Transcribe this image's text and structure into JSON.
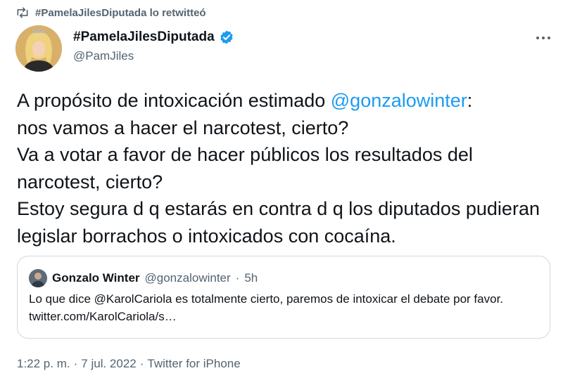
{
  "retweet": {
    "label": "#PamelaJilesDiputada lo retwitteó"
  },
  "author": {
    "display_name": "#PamelaJilesDiputada",
    "handle": "@PamJiles"
  },
  "tweet": {
    "text_part1": "A propósito de intoxicación estimado ",
    "mention": "@gonzalowinter",
    "text_part2": ":\nnos vamos a hacer el narcotest, cierto?\nVa a votar a favor de hacer públicos los resultados del narcotest, cierto?\nEstoy segura d q estarás en contra d q los diputados pudieran legislar borrachos o intoxicados con cocaína."
  },
  "quote": {
    "name": "Gonzalo Winter",
    "handle": "@gonzalowinter",
    "sep": "·",
    "time": "5h",
    "text": "Lo que dice @KarolCariola es totalmente cierto, paremos de intoxicar el debate por favor. twitter.com/KarolCariola/s…"
  },
  "meta": {
    "time": "1:22 p. m.",
    "sep1": "·",
    "date": "7 jul. 2022",
    "sep2": "·",
    "source": "Twitter for iPhone"
  },
  "colors": {
    "accent": "#1d9bf0",
    "secondary_text": "#536471",
    "border": "#cfd9de"
  },
  "icons": {
    "retweet": "retweet-icon",
    "verified": "verified-badge-icon",
    "more": "more-icon"
  }
}
